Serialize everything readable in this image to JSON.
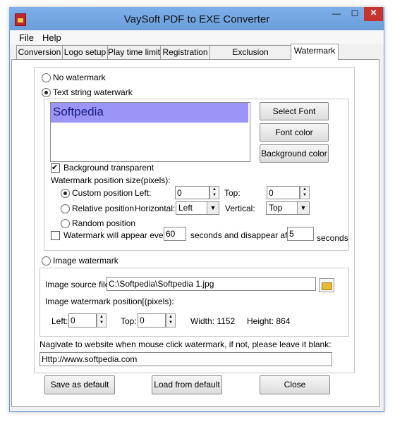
{
  "window": {
    "title": "VaySoft PDF to EXE Converter",
    "minimize": "—",
    "maximize": "☐",
    "close": "✕"
  },
  "menu": {
    "file": "File",
    "help": "Help"
  },
  "tabs": [
    {
      "label": "Conversion"
    },
    {
      "label": "Logo setup"
    },
    {
      "label": "Play time limit"
    },
    {
      "label": "Registration"
    },
    {
      "label": "Exclusion applications"
    },
    {
      "label": "Watermark",
      "active": true
    }
  ],
  "watermark": {
    "no_watermark": "No watermark",
    "text_string_watermark": "Text string waterwark",
    "preview_text": "Softpedia",
    "preview_color": "#9a95f7",
    "select_font": "Select Font",
    "font_color": "Font color",
    "background_color": "Background color",
    "background_transparent": "Background transparent",
    "position_size_label": "Watermark position size(pixels):",
    "custom_position": "Custom position",
    "left_label": "Left:",
    "left_value": "0",
    "top_label": "Top:",
    "top_value": "0",
    "relative_position": "Relative position",
    "horizontal_label": "Horizontal:",
    "horizontal_value": "Left",
    "vertical_label": "Vertical:",
    "vertical_value": "Top",
    "random_position": "Random position",
    "appear_label": "Watermark will appear every",
    "appear_value": "60",
    "disappear_label": "seconds and disappear after",
    "disappear_value": "5",
    "seconds": "seconds",
    "image_watermark": "Image watermark",
    "image_source_label": "Image source file:",
    "image_source_value": "C:\\Softpedia\\Softpedia 1.jpg",
    "image_position_label": "Image watermark position[(pixels):",
    "img_left_label": "Left:",
    "img_left_value": "0",
    "img_top_label": "Top:",
    "img_top_value": "0",
    "width_text": "Width: 1152",
    "height_text": "Height: 864",
    "navigate_label": "Nagivate to website when mouse click watermark, if not, please leave it blank:",
    "navigate_value": "Http://www.softpedia.com"
  },
  "buttons": {
    "save_default": "Save as default",
    "load_default": "Load from default",
    "close": "Close"
  }
}
